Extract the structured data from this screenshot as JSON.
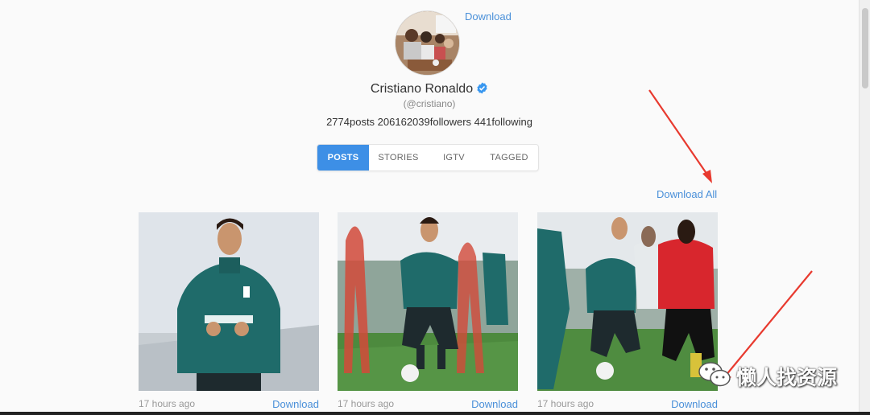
{
  "profile": {
    "download_label": "Download",
    "name": "Cristiano Ronaldo",
    "handle": "(@cristiano)",
    "stats": "2774posts 206162039followers 441following",
    "verified_icon": "verified-badge-icon",
    "accent": "#3d8fe6"
  },
  "tabs": [
    {
      "label": "POSTS",
      "active": true
    },
    {
      "label": "STORIES",
      "active": false
    },
    {
      "label": "IGTV",
      "active": false
    },
    {
      "label": "TAGGED",
      "active": false
    }
  ],
  "download_all_label": "Download All",
  "posts": [
    {
      "time": "17 hours ago",
      "download_label": "Download"
    },
    {
      "time": "17 hours ago",
      "download_label": "Download"
    },
    {
      "time": "17 hours ago",
      "download_label": "Download"
    }
  ],
  "watermark": {
    "text": "懒人找资源",
    "icon": "wechat-icon"
  },
  "colors": {
    "link": "#4a90d9",
    "arrow": "#e83a2f",
    "background": "#fafafa"
  }
}
